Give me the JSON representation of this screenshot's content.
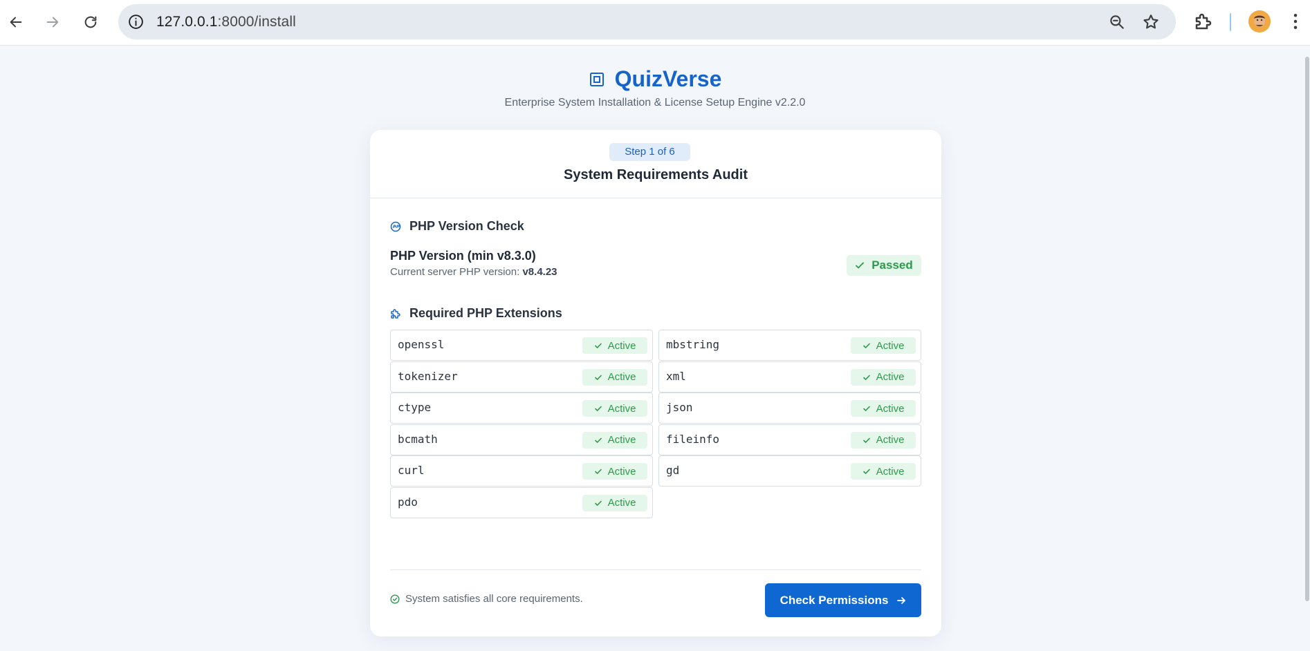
{
  "browser": {
    "url_host": "127.0.0.1",
    "url_path": ":8000/install",
    "back_icon": "arrow-left-icon",
    "forward_icon": "arrow-right-icon",
    "reload_icon": "reload-icon"
  },
  "header": {
    "app_name": "QuizVerse",
    "subtitle": "Enterprise System Installation & License Setup Engine v2.2.0"
  },
  "card": {
    "step": "Step 1 of 6",
    "title": "System Requirements Audit",
    "php_section_title": "PHP Version Check",
    "php_requirement": "PHP Version (min v8.3.0)",
    "php_current_prefix": "Current server PHP version: ",
    "php_current_value": "v8.4.23",
    "php_status": "Passed",
    "ext_section_title": "Required PHP Extensions",
    "extensions": [
      {
        "name": "openssl",
        "status": "Active"
      },
      {
        "name": "mbstring",
        "status": "Active"
      },
      {
        "name": "tokenizer",
        "status": "Active"
      },
      {
        "name": "xml",
        "status": "Active"
      },
      {
        "name": "ctype",
        "status": "Active"
      },
      {
        "name": "json",
        "status": "Active"
      },
      {
        "name": "bcmath",
        "status": "Active"
      },
      {
        "name": "fileinfo",
        "status": "Active"
      },
      {
        "name": "curl",
        "status": "Active"
      },
      {
        "name": "gd",
        "status": "Active"
      },
      {
        "name": "pdo",
        "status": "Active"
      }
    ],
    "footer_message": "System satisfies all core requirements.",
    "next_button": "Check Permissions"
  },
  "colors": {
    "brand": "#1663c9",
    "success": "#2f9a4d",
    "primary_button": "#0f67d2",
    "background": "#f3f6fb"
  }
}
